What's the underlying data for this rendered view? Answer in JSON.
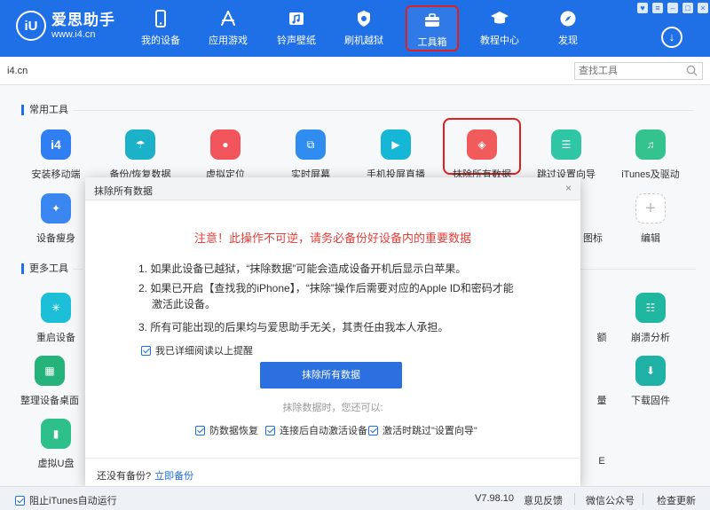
{
  "app": {
    "logo_mark": "iU",
    "name": "爱思助手",
    "url": "www.i4.cn"
  },
  "nav": [
    {
      "label": "我的设备",
      "icon": "phone-icon"
    },
    {
      "label": "应用游戏",
      "icon": "app-store-icon"
    },
    {
      "label": "铃声壁纸",
      "icon": "music-image-icon"
    },
    {
      "label": "刷机越狱",
      "icon": "shield-icon"
    },
    {
      "label": "工具箱",
      "icon": "toolbox-icon",
      "active": true
    },
    {
      "label": "教程中心",
      "icon": "graduation-cap-icon"
    },
    {
      "label": "发现",
      "icon": "compass-icon"
    }
  ],
  "tabbar": {
    "tab": "i4.cn",
    "search_placeholder": "查找工具"
  },
  "sections": {
    "common": "常用工具",
    "more": "更多工具"
  },
  "tools": {
    "install_mobile": "安装移动端",
    "backup_restore": "备份/恢复数据",
    "virtual_location": "虚拟定位",
    "realtime_screen": "实时屏幕",
    "screen_live": "手机投屏直播",
    "erase_all": "抹除所有数据",
    "skip_setup": "跳过设置向导",
    "itunes_driver": "iTunes及驱动",
    "device_cleanup": "设备瘦身",
    "partial_icon_label": "图标",
    "edit": "编辑",
    "reboot": "重启设备",
    "partial_quota": "额",
    "crash_analysis": "崩溃分析",
    "organize_desktop": "整理设备桌面",
    "partial_e": "量",
    "download_firmware": "下载固件",
    "virtual_udisk": "虚拟U盘",
    "partial_f": "E"
  },
  "dialog": {
    "title": "抹除所有数据",
    "close": "×",
    "warning": "注意！此操作不可逆，请务必备份好设备内的重要数据",
    "rule1": "1. 如果此设备已越狱，“抹除数据”可能会造成设备开机后显示白苹果。",
    "rule2a": "2. 如果已开启【查找我的iPhone】，“抹除”操作后需要对应的Apple ID和密码才能",
    "rule2b": "激活此设备。",
    "rule3": "3. 所有可能出现的后果均与爱思助手无关，其责任由我本人承担。",
    "confirm_read": "我已详细阅读以上提醒",
    "erase_button": "抹除所有数据",
    "hint": "抹除数据时，您还可以:",
    "opt1": "防数据恢复",
    "opt2": "连接后自动激活设备",
    "opt3": "激活时跳过\"设置向导\"",
    "footer_question": "还没有备份?",
    "footer_link": "立即备份"
  },
  "statusbar": {
    "block_itunes": "阻止iTunes自动运行",
    "version": "V7.98.10",
    "feedback": "意见反馈",
    "wechat": "微信公众号",
    "update": "检查更新"
  },
  "colors": {
    "brand": "#1f6fe6",
    "warning": "#e5403b",
    "highlight_border": "#e02020"
  }
}
